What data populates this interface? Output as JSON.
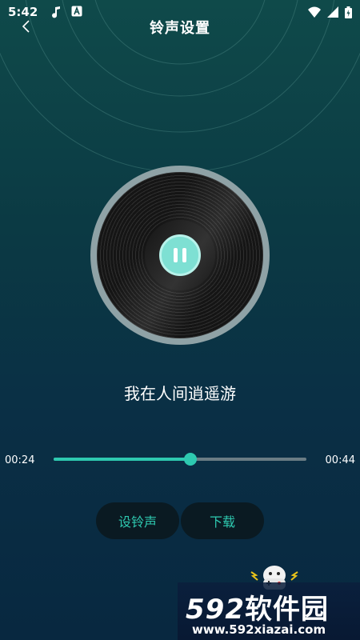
{
  "status_bar": {
    "time": "5:42"
  },
  "header": {
    "title": "铃声设置"
  },
  "player": {
    "song_title": "我在人间逍遥游",
    "current_time": "00:24",
    "total_time": "00:44",
    "progress_fraction": 0.54,
    "state": "playing"
  },
  "actions": {
    "set_ringtone_label": "设铃声",
    "download_label": "下载"
  },
  "watermark": {
    "logo_num": "592",
    "logo_text": "软件园",
    "url": "www.592xiazai.com"
  },
  "colors": {
    "accent": "#2ec9b0",
    "pause_button": "#7ee0d3",
    "disc_rim": "#8fa2a6",
    "button_bg": "#0a1a22"
  },
  "icons": [
    "back-arrow-icon",
    "music-note-icon",
    "app-a-icon",
    "wifi-icon",
    "signal-icon",
    "battery-icon",
    "pause-icon"
  ]
}
